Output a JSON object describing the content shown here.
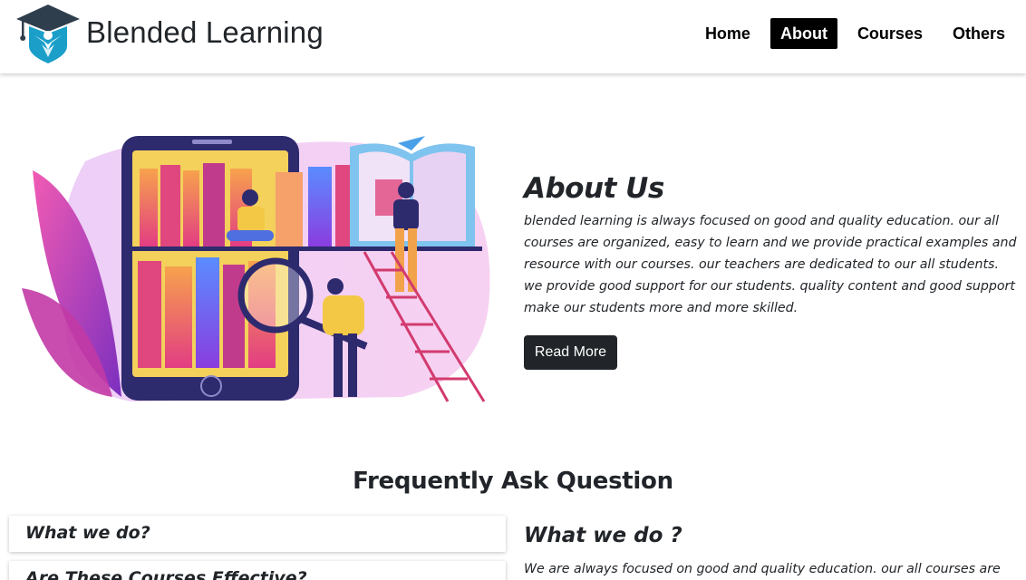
{
  "brand": {
    "name": "Blended Learning",
    "logo_icon": "graduation-cap-student-icon"
  },
  "nav": {
    "items": [
      {
        "label": "Home",
        "active": false
      },
      {
        "label": "About",
        "active": true
      },
      {
        "label": "Courses",
        "active": false
      },
      {
        "label": "Others",
        "active": false
      }
    ]
  },
  "about": {
    "title": "About Us",
    "body": "blended learning is always focused on good and quality education. our all courses are organized, easy to learn and we provide practical examples and resource with our courses. our teachers are dedicated to our all students. we provide good support for our students. quality content and good support make our students more and more skilled.",
    "button_label": "Read More",
    "illustration": "online-library-illustration"
  },
  "faq": {
    "title": "Frequently Ask Question",
    "questions": [
      {
        "label": "What we do?"
      },
      {
        "label": "Are These Courses Effective?"
      }
    ],
    "answer": {
      "title": "What we do ?",
      "body": "We are always focused on good and quality education. our all courses are"
    }
  },
  "colors": {
    "accent_dark": "#212529",
    "nav_active_bg": "#000000",
    "logo_teal": "#1b9fc9",
    "logo_cap": "#2f3e4d"
  }
}
